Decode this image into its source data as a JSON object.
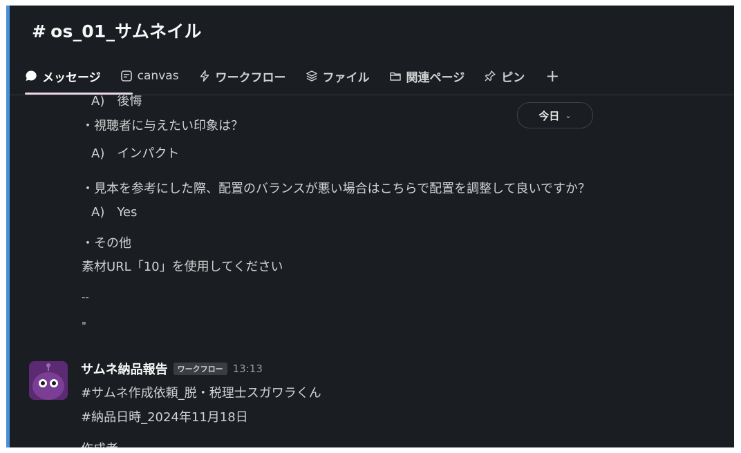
{
  "channel": {
    "title": "os_01_サムネイル",
    "hash": "#"
  },
  "tabs": [
    {
      "label": "メッセージ",
      "icon": "message-icon",
      "active": true
    },
    {
      "label": "canvas",
      "icon": "canvas-icon"
    },
    {
      "label": "ワークフロー",
      "icon": "workflow-icon"
    },
    {
      "label": "ファイル",
      "icon": "files-icon"
    },
    {
      "label": "関連ページ",
      "icon": "folder-icon"
    },
    {
      "label": "ピン",
      "icon": "pin-icon"
    }
  ],
  "add_tab_label": "+",
  "date_divider": {
    "label": "今日",
    "chevron": "⌄"
  },
  "prev_message": {
    "lines": [
      "A)　後悔",
      "・視聴者に与えたい印象は？",
      "A)　インパクト",
      "・見本を参考にした際、配置のバランスが悪い場合はこちらで配置を調整して良いですか？",
      "A)　Yes",
      "・その他",
      "素材URL「10」を使用してください",
      "--",
      "\""
    ]
  },
  "message": {
    "sender": "サムネ納品報告",
    "badge": "ワークフロー",
    "time": "13:13",
    "lines": [
      "#サムネ作成依頼_脱・税理士スガワラくん",
      "#納品日時_2024年11月18日",
      "作成者"
    ]
  },
  "colors": {
    "background": "#1a1d21",
    "accent": "#4a90d9",
    "avatar_bg": "#5b2a73",
    "active_underline": "#e8d8e8"
  }
}
